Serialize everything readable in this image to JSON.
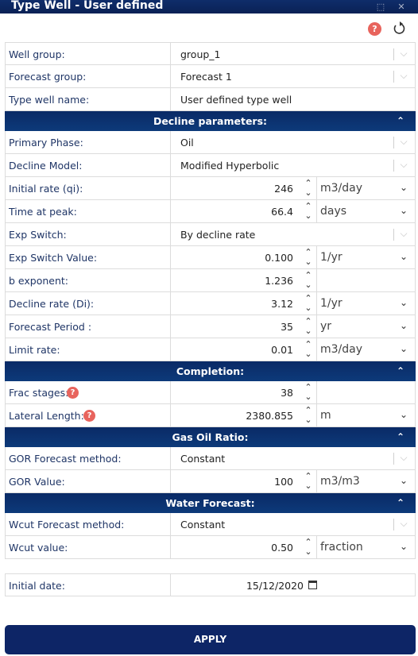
{
  "window": {
    "title": "Type Well - User defined"
  },
  "toolbar": {
    "help_icon": "?"
  },
  "fields": {
    "well_group": {
      "label": "Well group:",
      "value": "group_1"
    },
    "forecast_group": {
      "label": "Forecast group:",
      "value": "Forecast 1"
    },
    "type_well_name": {
      "label": "Type well name:",
      "value": "User defined type well"
    }
  },
  "decline": {
    "header": "Decline parameters:",
    "primary_phase": {
      "label": "Primary Phase:",
      "value": "Oil"
    },
    "decline_model": {
      "label": "Decline Model:",
      "value": "Modified Hyperbolic"
    },
    "initial_rate": {
      "label": "Initial rate (qi):",
      "value": "246",
      "unit": "m3/day"
    },
    "time_at_peak": {
      "label": "Time at peak:",
      "value": "66.4",
      "unit": "days"
    },
    "exp_switch": {
      "label": "Exp Switch:",
      "value": "By decline rate"
    },
    "exp_switch_value": {
      "label": "Exp Switch Value:",
      "value": "0.100",
      "unit": "1/yr"
    },
    "b_exponent": {
      "label": "b exponent:",
      "value": "1.236"
    },
    "decline_rate": {
      "label": "Decline rate (Di):",
      "value": "3.12",
      "unit": "1/yr"
    },
    "forecast_period": {
      "label": "Forecast Period :",
      "value": "35",
      "unit": "yr"
    },
    "limit_rate": {
      "label": "Limit rate:",
      "value": "0.01",
      "unit": "m3/day"
    }
  },
  "completion": {
    "header": "Completion:",
    "frac_stages": {
      "label": "Frac stages:",
      "value": "38"
    },
    "lateral_length": {
      "label": "Lateral Length:",
      "value": "2380.855",
      "unit": "m"
    }
  },
  "gor": {
    "header": "Gas Oil Ratio:",
    "method": {
      "label": "GOR Forecast method:",
      "value": "Constant"
    },
    "value": {
      "label": "GOR Value:",
      "value": "100",
      "unit": "m3/m3"
    }
  },
  "water": {
    "header": "Water Forecast:",
    "method": {
      "label": "Wcut Forecast method:",
      "value": "Constant"
    },
    "value": {
      "label": "Wcut value:",
      "value": "0.50",
      "unit": "fraction"
    }
  },
  "initial_date": {
    "label": "Initial date:",
    "value": "15/12/2020"
  },
  "apply_label": "APPLY",
  "icons": {
    "help": "help-icon",
    "reset": "reset-icon",
    "chevron": "chevron-down-icon",
    "calendar": "calendar-icon"
  }
}
